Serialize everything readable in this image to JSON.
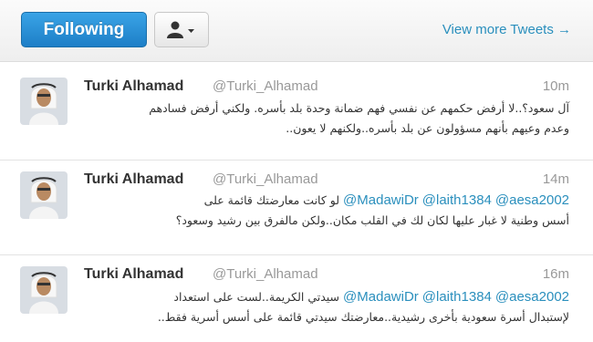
{
  "header": {
    "follow_label": "Following",
    "view_more_label": "View more Tweets →"
  },
  "tweets": [
    {
      "name": "Turki Alhamad",
      "handle": "@Turki_Alhamad",
      "time": "10m",
      "line1": "آل سعود؟..لا أرفض حكمهم عن نفسي فهم ضمانة وحدة بلد بأسره. ولكني أرفض فسادهم",
      "line2": "وعدم وعيهم بأنهم مسؤولون عن بلد بأسره..ولكنهم لا يعون.."
    },
    {
      "name": "Turki Alhamad",
      "handle": "@Turki_Alhamad",
      "time": "14m",
      "mentions": [
        "@MadawiDr",
        "@laith1384",
        "@aesa2002"
      ],
      "line1_rest": "لو كانت معارضتك قائمة على",
      "line2": "أسس وطنية لا غبار عليها لكان لك في القلب مكان..ولكن مالفرق بين رشيد وسعود؟"
    },
    {
      "name": "Turki Alhamad",
      "handle": "@Turki_Alhamad",
      "time": "16m",
      "mentions": [
        "@MadawiDr",
        "@laith1384",
        "@aesa2002"
      ],
      "line1_rest": "سيدتي الكريمة..لست على استعداد",
      "line2": "لإستبدال أسرة سعودية بأخرى رشيدية..معارضتك سيدتي قائمة على أسس أسرية فقط.."
    }
  ],
  "colors": {
    "follow_button": "#2a8fd6",
    "link": "#2a8fbd",
    "muted": "#999999"
  }
}
